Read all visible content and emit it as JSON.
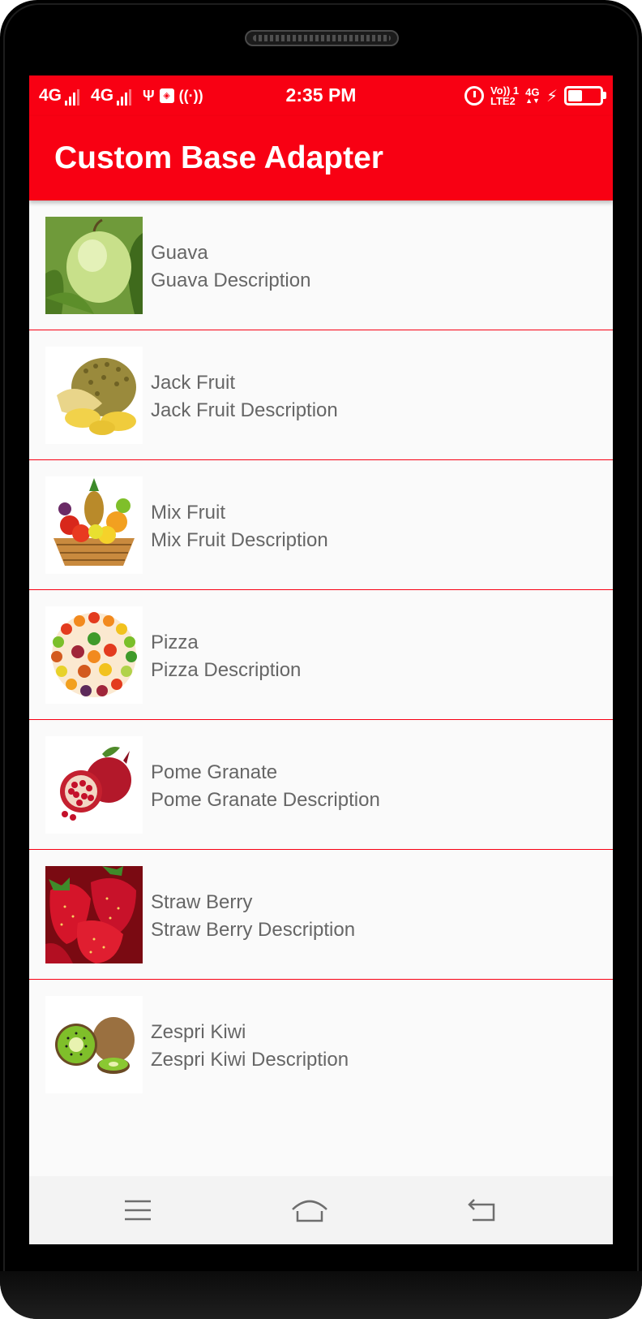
{
  "status_bar": {
    "network_1": "4G",
    "network_2": "4G",
    "time": "2:35 PM",
    "volte_top": "Vo)) 1",
    "volte_bottom": "LTE2",
    "network_right": "4G",
    "battery_level": 0.4
  },
  "app_bar": {
    "title": "Custom Base Adapter"
  },
  "items": [
    {
      "name": "Guava",
      "description": "Guava Description",
      "image": "guava-image"
    },
    {
      "name": "Jack Fruit",
      "description": "Jack Fruit Description",
      "image": "jack-fruit-image"
    },
    {
      "name": "Mix Fruit",
      "description": "Mix Fruit Description",
      "image": "mix-fruit-basket-image"
    },
    {
      "name": "Pizza",
      "description": "Pizza Description",
      "image": "vegetable-circle-image"
    },
    {
      "name": "Pome Granate",
      "description": "Pome Granate Description",
      "image": "pomegranate-image"
    },
    {
      "name": "Straw Berry",
      "description": "Straw Berry Description",
      "image": "strawberry-image"
    },
    {
      "name": "Zespri Kiwi",
      "description": "Zespri Kiwi Description",
      "image": "kiwi-image"
    }
  ],
  "nav_bar": {
    "icons": [
      "menu-icon",
      "home-icon",
      "back-icon"
    ]
  },
  "colors": {
    "accent": "#f80013",
    "divider": "#f80013",
    "list_background": "#fafafa",
    "item_text": "#666666"
  }
}
